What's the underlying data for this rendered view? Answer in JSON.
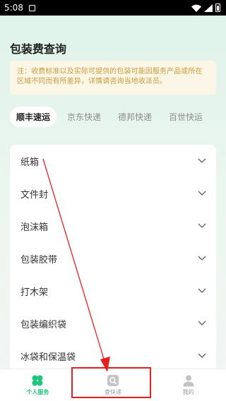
{
  "status_bar": {
    "time": "5:08"
  },
  "header": {
    "title": "包装费查询"
  },
  "notice": {
    "text": "注：收费标准以及实际可提供的包装可能因服务产品或所在区域不同而有所差异，详情请咨询当地收派员。"
  },
  "carrier_tabs": [
    {
      "label": "顺丰速运",
      "active": true
    },
    {
      "label": "京东快递",
      "active": false
    },
    {
      "label": "德邦快递",
      "active": false
    },
    {
      "label": "百世快运",
      "active": false
    }
  ],
  "packaging_items": [
    {
      "label": "纸箱"
    },
    {
      "label": "文件封"
    },
    {
      "label": "泡沫箱"
    },
    {
      "label": "包装胶带"
    },
    {
      "label": "打木架"
    },
    {
      "label": "包装编织袋"
    },
    {
      "label": "冰袋和保温袋"
    }
  ],
  "bottom_nav": [
    {
      "label": "个人服务",
      "icon": "clover-icon",
      "active": true
    },
    {
      "label": "查快递",
      "icon": "search-package-icon",
      "active": false
    },
    {
      "label": "我的",
      "icon": "user-icon",
      "active": false
    }
  ],
  "colors": {
    "accent_green": "#20c57e",
    "notice_text": "#c99a3c",
    "notice_bg": "#fbf6e6",
    "annotation_red": "#e81f1f"
  }
}
